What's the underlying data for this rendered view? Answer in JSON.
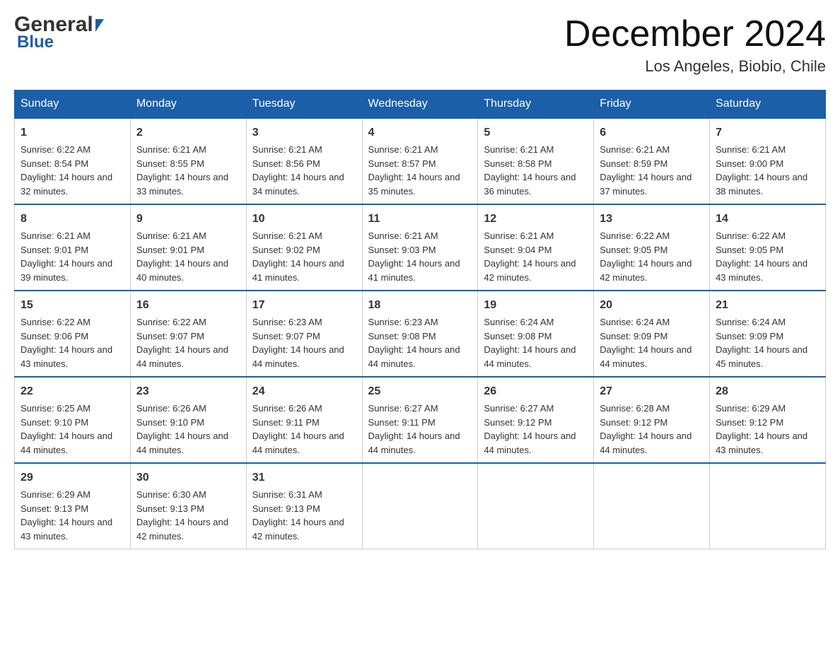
{
  "header": {
    "month_title": "December 2024",
    "location": "Los Angeles, Biobio, Chile"
  },
  "days_of_week": [
    "Sunday",
    "Monday",
    "Tuesday",
    "Wednesday",
    "Thursday",
    "Friday",
    "Saturday"
  ],
  "weeks": [
    [
      {
        "day": "1",
        "sunrise": "6:22 AM",
        "sunset": "8:54 PM",
        "daylight": "14 hours and 32 minutes."
      },
      {
        "day": "2",
        "sunrise": "6:21 AM",
        "sunset": "8:55 PM",
        "daylight": "14 hours and 33 minutes."
      },
      {
        "day": "3",
        "sunrise": "6:21 AM",
        "sunset": "8:56 PM",
        "daylight": "14 hours and 34 minutes."
      },
      {
        "day": "4",
        "sunrise": "6:21 AM",
        "sunset": "8:57 PM",
        "daylight": "14 hours and 35 minutes."
      },
      {
        "day": "5",
        "sunrise": "6:21 AM",
        "sunset": "8:58 PM",
        "daylight": "14 hours and 36 minutes."
      },
      {
        "day": "6",
        "sunrise": "6:21 AM",
        "sunset": "8:59 PM",
        "daylight": "14 hours and 37 minutes."
      },
      {
        "day": "7",
        "sunrise": "6:21 AM",
        "sunset": "9:00 PM",
        "daylight": "14 hours and 38 minutes."
      }
    ],
    [
      {
        "day": "8",
        "sunrise": "6:21 AM",
        "sunset": "9:01 PM",
        "daylight": "14 hours and 39 minutes."
      },
      {
        "day": "9",
        "sunrise": "6:21 AM",
        "sunset": "9:01 PM",
        "daylight": "14 hours and 40 minutes."
      },
      {
        "day": "10",
        "sunrise": "6:21 AM",
        "sunset": "9:02 PM",
        "daylight": "14 hours and 41 minutes."
      },
      {
        "day": "11",
        "sunrise": "6:21 AM",
        "sunset": "9:03 PM",
        "daylight": "14 hours and 41 minutes."
      },
      {
        "day": "12",
        "sunrise": "6:21 AM",
        "sunset": "9:04 PM",
        "daylight": "14 hours and 42 minutes."
      },
      {
        "day": "13",
        "sunrise": "6:22 AM",
        "sunset": "9:05 PM",
        "daylight": "14 hours and 42 minutes."
      },
      {
        "day": "14",
        "sunrise": "6:22 AM",
        "sunset": "9:05 PM",
        "daylight": "14 hours and 43 minutes."
      }
    ],
    [
      {
        "day": "15",
        "sunrise": "6:22 AM",
        "sunset": "9:06 PM",
        "daylight": "14 hours and 43 minutes."
      },
      {
        "day": "16",
        "sunrise": "6:22 AM",
        "sunset": "9:07 PM",
        "daylight": "14 hours and 44 minutes."
      },
      {
        "day": "17",
        "sunrise": "6:23 AM",
        "sunset": "9:07 PM",
        "daylight": "14 hours and 44 minutes."
      },
      {
        "day": "18",
        "sunrise": "6:23 AM",
        "sunset": "9:08 PM",
        "daylight": "14 hours and 44 minutes."
      },
      {
        "day": "19",
        "sunrise": "6:24 AM",
        "sunset": "9:08 PM",
        "daylight": "14 hours and 44 minutes."
      },
      {
        "day": "20",
        "sunrise": "6:24 AM",
        "sunset": "9:09 PM",
        "daylight": "14 hours and 44 minutes."
      },
      {
        "day": "21",
        "sunrise": "6:24 AM",
        "sunset": "9:09 PM",
        "daylight": "14 hours and 45 minutes."
      }
    ],
    [
      {
        "day": "22",
        "sunrise": "6:25 AM",
        "sunset": "9:10 PM",
        "daylight": "14 hours and 44 minutes."
      },
      {
        "day": "23",
        "sunrise": "6:26 AM",
        "sunset": "9:10 PM",
        "daylight": "14 hours and 44 minutes."
      },
      {
        "day": "24",
        "sunrise": "6:26 AM",
        "sunset": "9:11 PM",
        "daylight": "14 hours and 44 minutes."
      },
      {
        "day": "25",
        "sunrise": "6:27 AM",
        "sunset": "9:11 PM",
        "daylight": "14 hours and 44 minutes."
      },
      {
        "day": "26",
        "sunrise": "6:27 AM",
        "sunset": "9:12 PM",
        "daylight": "14 hours and 44 minutes."
      },
      {
        "day": "27",
        "sunrise": "6:28 AM",
        "sunset": "9:12 PM",
        "daylight": "14 hours and 44 minutes."
      },
      {
        "day": "28",
        "sunrise": "6:29 AM",
        "sunset": "9:12 PM",
        "daylight": "14 hours and 43 minutes."
      }
    ],
    [
      {
        "day": "29",
        "sunrise": "6:29 AM",
        "sunset": "9:13 PM",
        "daylight": "14 hours and 43 minutes."
      },
      {
        "day": "30",
        "sunrise": "6:30 AM",
        "sunset": "9:13 PM",
        "daylight": "14 hours and 42 minutes."
      },
      {
        "day": "31",
        "sunrise": "6:31 AM",
        "sunset": "9:13 PM",
        "daylight": "14 hours and 42 minutes."
      },
      null,
      null,
      null,
      null
    ]
  ]
}
